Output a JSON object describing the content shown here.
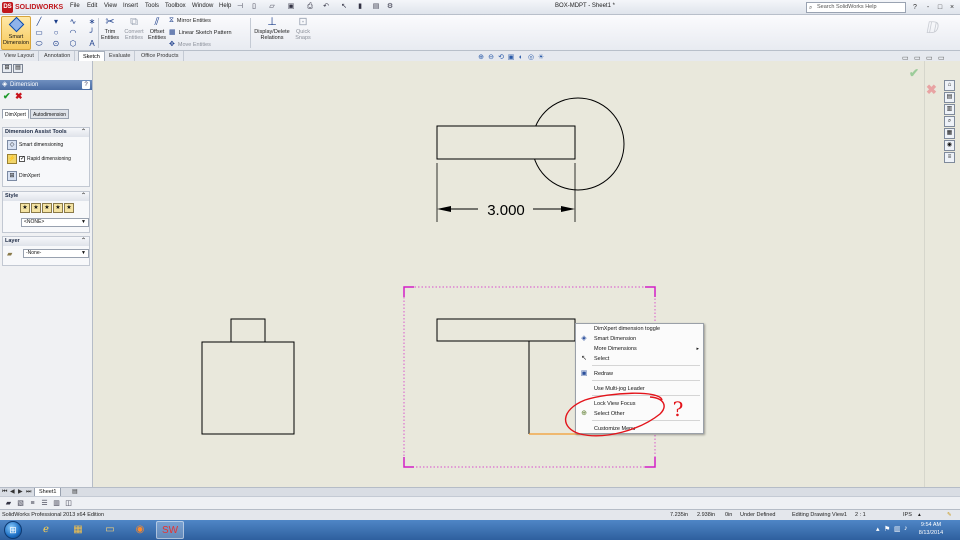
{
  "app": {
    "logo_text": "SOLIDWORKS",
    "logo_badge": "DS",
    "menus": [
      "File",
      "Edit",
      "View",
      "Insert",
      "Tools",
      "Toolbox",
      "Window",
      "Help"
    ],
    "document_title": "BOX-MDPT - Sheet1 *",
    "help_search_placeholder": "Search SolidWorks Help",
    "window_controls": [
      "-",
      "□",
      "×"
    ]
  },
  "command_manager": {
    "smart_dimension_label": "Smart Dimension",
    "trim_entities_label": "Trim Entities",
    "convert_entities_label": "Convert Entities",
    "offset_entities_label": "Offset Entities",
    "mirror_entities_label": "Mirror Entities",
    "linear_sketch_pattern_label": "Linear Sketch Pattern",
    "move_entities_label": "Move Entities",
    "display_delete_relations_label": "Display/Delete Relations",
    "quick_snaps_label": "Quick Snaps",
    "tabs": [
      "View Layout",
      "Annotation",
      "Sketch",
      "Evaluate",
      "Office Products"
    ],
    "active_tab": "Sketch"
  },
  "property_manager": {
    "title": "Dimension",
    "help_glyph": "?",
    "tabs": [
      "DimXpert",
      "Autodimension"
    ],
    "dimension_assist_title": "Dimension Assist Tools",
    "smart_dimensioning_label": "Smart dimensioning",
    "rapid_dimensioning_label": "Rapid dimensioning",
    "rapid_dimensioning_checked": true,
    "dimxpert_label": "DimXpert",
    "style_title": "Style",
    "style_value": "<NONE>",
    "layer_title": "Layer",
    "layer_value": "-None-"
  },
  "drawing": {
    "dimension_text": "3.000",
    "annotation_text": "?"
  },
  "context_menu": {
    "items": [
      {
        "label": "DimXpert dimension toggle",
        "icon": ""
      },
      {
        "label": "Smart Dimension",
        "icon": "smart-dimension-icon"
      },
      {
        "label": "More Dimensions",
        "icon": "",
        "submenu": true
      },
      {
        "label": "Select",
        "icon": "select-arrow-icon"
      },
      {
        "label": "Redraw",
        "icon": "redraw-icon"
      },
      {
        "label": "Use Multi-jog Leader",
        "icon": ""
      },
      {
        "label": "Lock View Focus",
        "icon": ""
      },
      {
        "label": "Select Other",
        "icon": "select-other-icon"
      },
      {
        "label": "Customize Menu",
        "icon": ""
      }
    ]
  },
  "sheet_tabs": {
    "sheet_name": "Sheet1"
  },
  "status_bar": {
    "product": "SolidWorks Professional 2013 x64 Edition",
    "x_coord": "7.235in",
    "y_coord": "2.938in",
    "z_coord": "0in",
    "state": "Under Defined",
    "mode": "Editing Drawing View1",
    "scale": "2 : 1",
    "units": "IPS"
  },
  "taskbar": {
    "time": "9:54 AM",
    "date": "8/13/2014"
  },
  "colors": {
    "sketch_line": "#000000",
    "selection_box": "#d21fc6",
    "annotation_red": "#e3141b",
    "highlight_orange": "#f39a2e"
  }
}
